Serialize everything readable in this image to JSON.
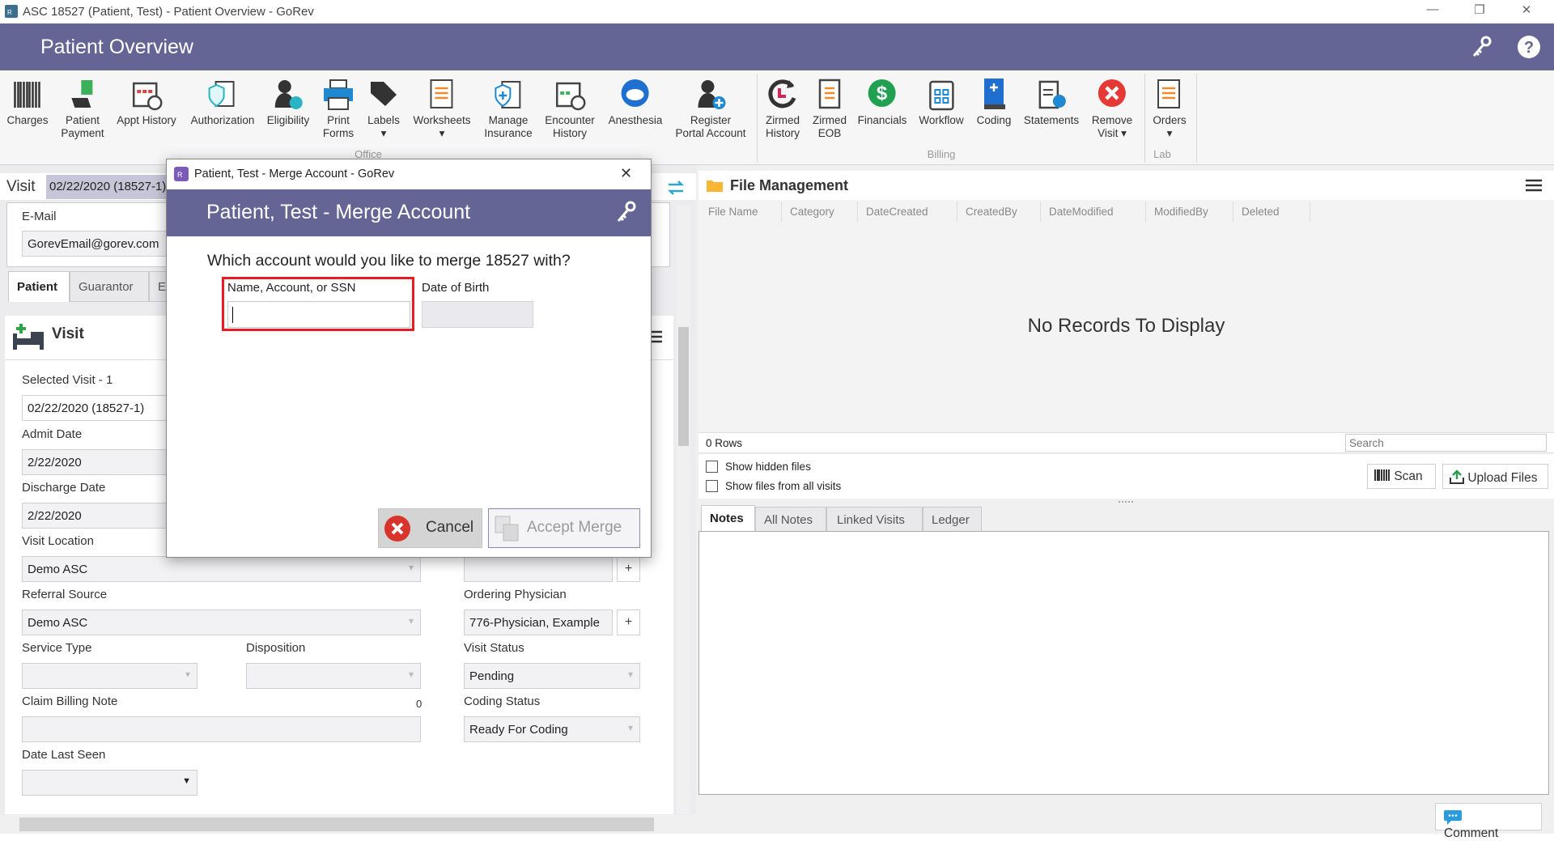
{
  "window": {
    "title": "ASC 18527 (Patient, Test) - Patient Overview - GoRev",
    "minimize": "—",
    "restore": "❐",
    "close": "✕"
  },
  "header": {
    "title": "Patient Overview",
    "icons": [
      "keys-icon",
      "help-icon"
    ]
  },
  "ribbon": {
    "groups": [
      {
        "label": "Office"
      },
      {
        "label": "Billing"
      },
      {
        "label": "Lab"
      }
    ],
    "buttons": [
      {
        "label": "Charges",
        "icon": "barcode-icon"
      },
      {
        "label": "Patient\nPayment",
        "icon": "cash-hand-icon"
      },
      {
        "label": "Appt History",
        "icon": "calendar-clock-icon"
      },
      {
        "label": "Authorization",
        "icon": "shield-clipboard-icon"
      },
      {
        "label": "Eligibility",
        "icon": "user-check-icon"
      },
      {
        "label": "Print\nForms",
        "icon": "printer-icon"
      },
      {
        "label": "Labels\n▾",
        "icon": "tag-icon"
      },
      {
        "label": "Worksheets\n▾",
        "icon": "document-icon"
      },
      {
        "label": "Manage\nInsurance",
        "icon": "insurance-icon"
      },
      {
        "label": "Encounter\nHistory",
        "icon": "calendar-history-icon"
      },
      {
        "label": "Anesthesia",
        "icon": "anesthesia-icon"
      },
      {
        "label": "Register\nPortal Account",
        "icon": "user-add-icon"
      },
      {
        "label": "Zirmed\nHistory",
        "icon": "refresh-history-icon"
      },
      {
        "label": "Zirmed\nEOB",
        "icon": "eob-document-icon"
      },
      {
        "label": "Financials",
        "icon": "dollar-icon"
      },
      {
        "label": "Workflow",
        "icon": "workflow-clipboard-icon"
      },
      {
        "label": "Coding",
        "icon": "book-icon"
      },
      {
        "label": "Statements",
        "icon": "statement-info-icon"
      },
      {
        "label": "Remove\nVisit ▾",
        "icon": "remove-icon"
      },
      {
        "label": "Orders\n▾",
        "icon": "orders-icon"
      }
    ]
  },
  "left": {
    "visit_label": "Visit",
    "visit_value": "02/22/2020 (18527-1)",
    "email_label": "E-Mail",
    "email_value": "GorevEmail@gorev.com",
    "tabs": [
      "Patient",
      "Guarantor",
      "E"
    ],
    "section_title": "Visit",
    "fields": {
      "selected_visit_label": "Selected Visit - 1",
      "selected_visit_value": "02/22/2020 (18527-1)",
      "admit_label": "Admit Date",
      "admit_value": "2/22/2020",
      "discharge_label": "Discharge Date",
      "discharge_value": "2/22/2020",
      "location_label": "Visit Location",
      "location_value": "Demo ASC",
      "referral_label": "Referral Source",
      "referral_value": "Demo ASC",
      "ordering_label": "Ordering Physician",
      "ordering_value": "776-Physician, Example",
      "service_label": "Service Type",
      "service_value": "",
      "disposition_label": "Disposition",
      "disposition_value": "",
      "status_label": "Visit Status",
      "status_value": "Pending",
      "note_label": "Claim Billing Note",
      "note_count": "0",
      "note_value": "",
      "coding_label": "Coding Status",
      "coding_value": "Ready For Coding",
      "last_seen_label": "Date Last Seen",
      "last_seen_value": ""
    },
    "plus": "+"
  },
  "files": {
    "title": "File Management",
    "columns": [
      "File Name",
      "Category",
      "DateCreated",
      "CreatedBy",
      "DateModified",
      "ModifiedBy",
      "Deleted"
    ],
    "empty": "No Records To Display",
    "rows": "0 Rows",
    "search_placeholder": "Search",
    "show_hidden": "Show hidden files",
    "show_all_visits": "Show files from all visits",
    "scan": "Scan",
    "upload": "Upload Files",
    "tabs": [
      "Notes",
      "All Notes",
      "Linked Visits",
      "Ledger"
    ],
    "comment": "Comment"
  },
  "dialog": {
    "window_title": "Patient, Test - Merge Account - GoRev",
    "close": "✕",
    "title": "Patient, Test - Merge Account",
    "question": "Which account would you like to merge 18527 with?",
    "search_label": "Name, Account, or SSN",
    "search_value": "",
    "dob_label": "Date of Birth",
    "dob_value": "",
    "cancel": "Cancel",
    "accept": "Accept Merge",
    "highlight_color": "#e81c24"
  },
  "colors": {
    "brand": "#646495"
  }
}
